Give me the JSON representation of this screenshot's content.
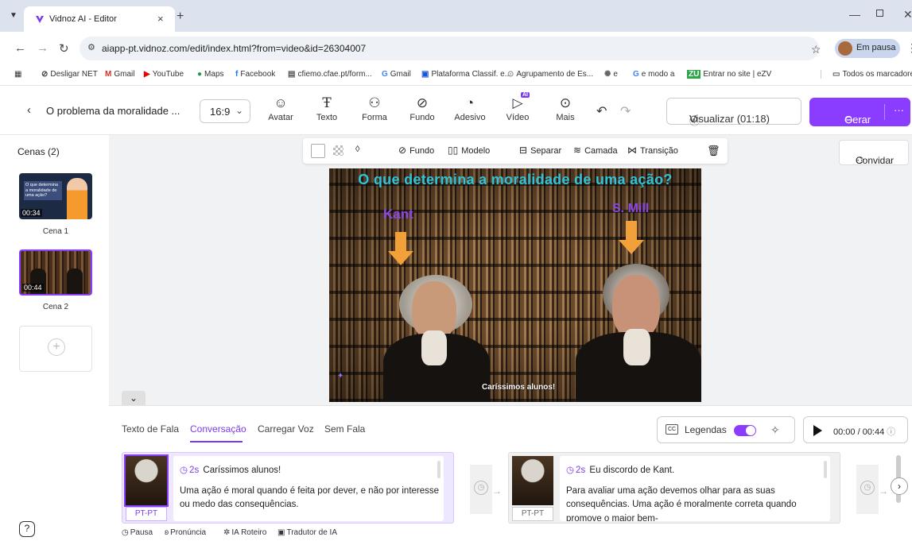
{
  "browser": {
    "tab_title": "Vidnoz AI - Editor",
    "url": "aiapp-pt.vidnoz.com/edit/index.html?from=video&id=26304007",
    "profile_status": "Em pausa",
    "bookmarks": [
      "Desligar NET",
      "Gmail",
      "YouTube",
      "Maps",
      "Facebook",
      "cfiemo.cfae.pt/form...",
      "Gmail",
      "Plataforma Classif. e...",
      "Agrupamento de Es...",
      "e",
      "e modo a",
      "Entrar no site | eZV"
    ],
    "all_bookmarks": "Todos os marcadores"
  },
  "editor": {
    "project_title": "O problema da moralidade ...",
    "aspect_ratio": "16:9",
    "tools": [
      "Avatar",
      "Texto",
      "Forma",
      "Fundo",
      "Adesivo",
      "Vídeo",
      "Mais"
    ],
    "ai_badge": "AI",
    "preview_label": "Visualizar (01:18)",
    "generate_label": "Gerar",
    "invite_label": "Convidar"
  },
  "scenes": {
    "title": "Cenas (2)",
    "items": [
      {
        "label": "Cena 1",
        "duration": "00:34",
        "thumb_text": "O que determina a moralidade de uma ação?"
      },
      {
        "label": "Cena 2",
        "duration": "00:44"
      }
    ]
  },
  "canvas_toolbar": [
    "Fundo",
    "Modelo",
    "Separar",
    "Camada",
    "Transição"
  ],
  "video": {
    "title": "O que determina a moralidade de uma ação?",
    "label_left": "Kant",
    "label_right": "S. Mill",
    "subtitle": "Caríssimos alunos!",
    "colors": {
      "title": "#2fc2d8",
      "labels": "#8a47e8",
      "arrows": "#f2a13a"
    }
  },
  "bottom": {
    "tabs": [
      "Texto de Fala",
      "Conversação",
      "Carregar Voz",
      "Sem Fala"
    ],
    "active_tab": "Conversação",
    "captions_label": "Legendas",
    "captions_on": true,
    "play_time": "00:00 / 00:44",
    "cards": [
      {
        "duration": "2s",
        "heading": "Caríssimos alunos!",
        "text": "Uma ação é moral quando é feita por dever, e não por interesse ou medo das consequências.",
        "lang": "PT-PT"
      },
      {
        "duration": "2s",
        "heading": "Eu discordo de Kant.",
        "text": "Para avaliar uma ação devemos olhar para as suas consequências. Uma ação é moralmente correta quando promove o maior bem-",
        "lang": "PT-PT"
      }
    ],
    "footer_tools": [
      "Pausa",
      "Pronúncia",
      "IA Roteiro",
      "Tradutor de IA"
    ]
  },
  "accent_color": "#8b3dff"
}
